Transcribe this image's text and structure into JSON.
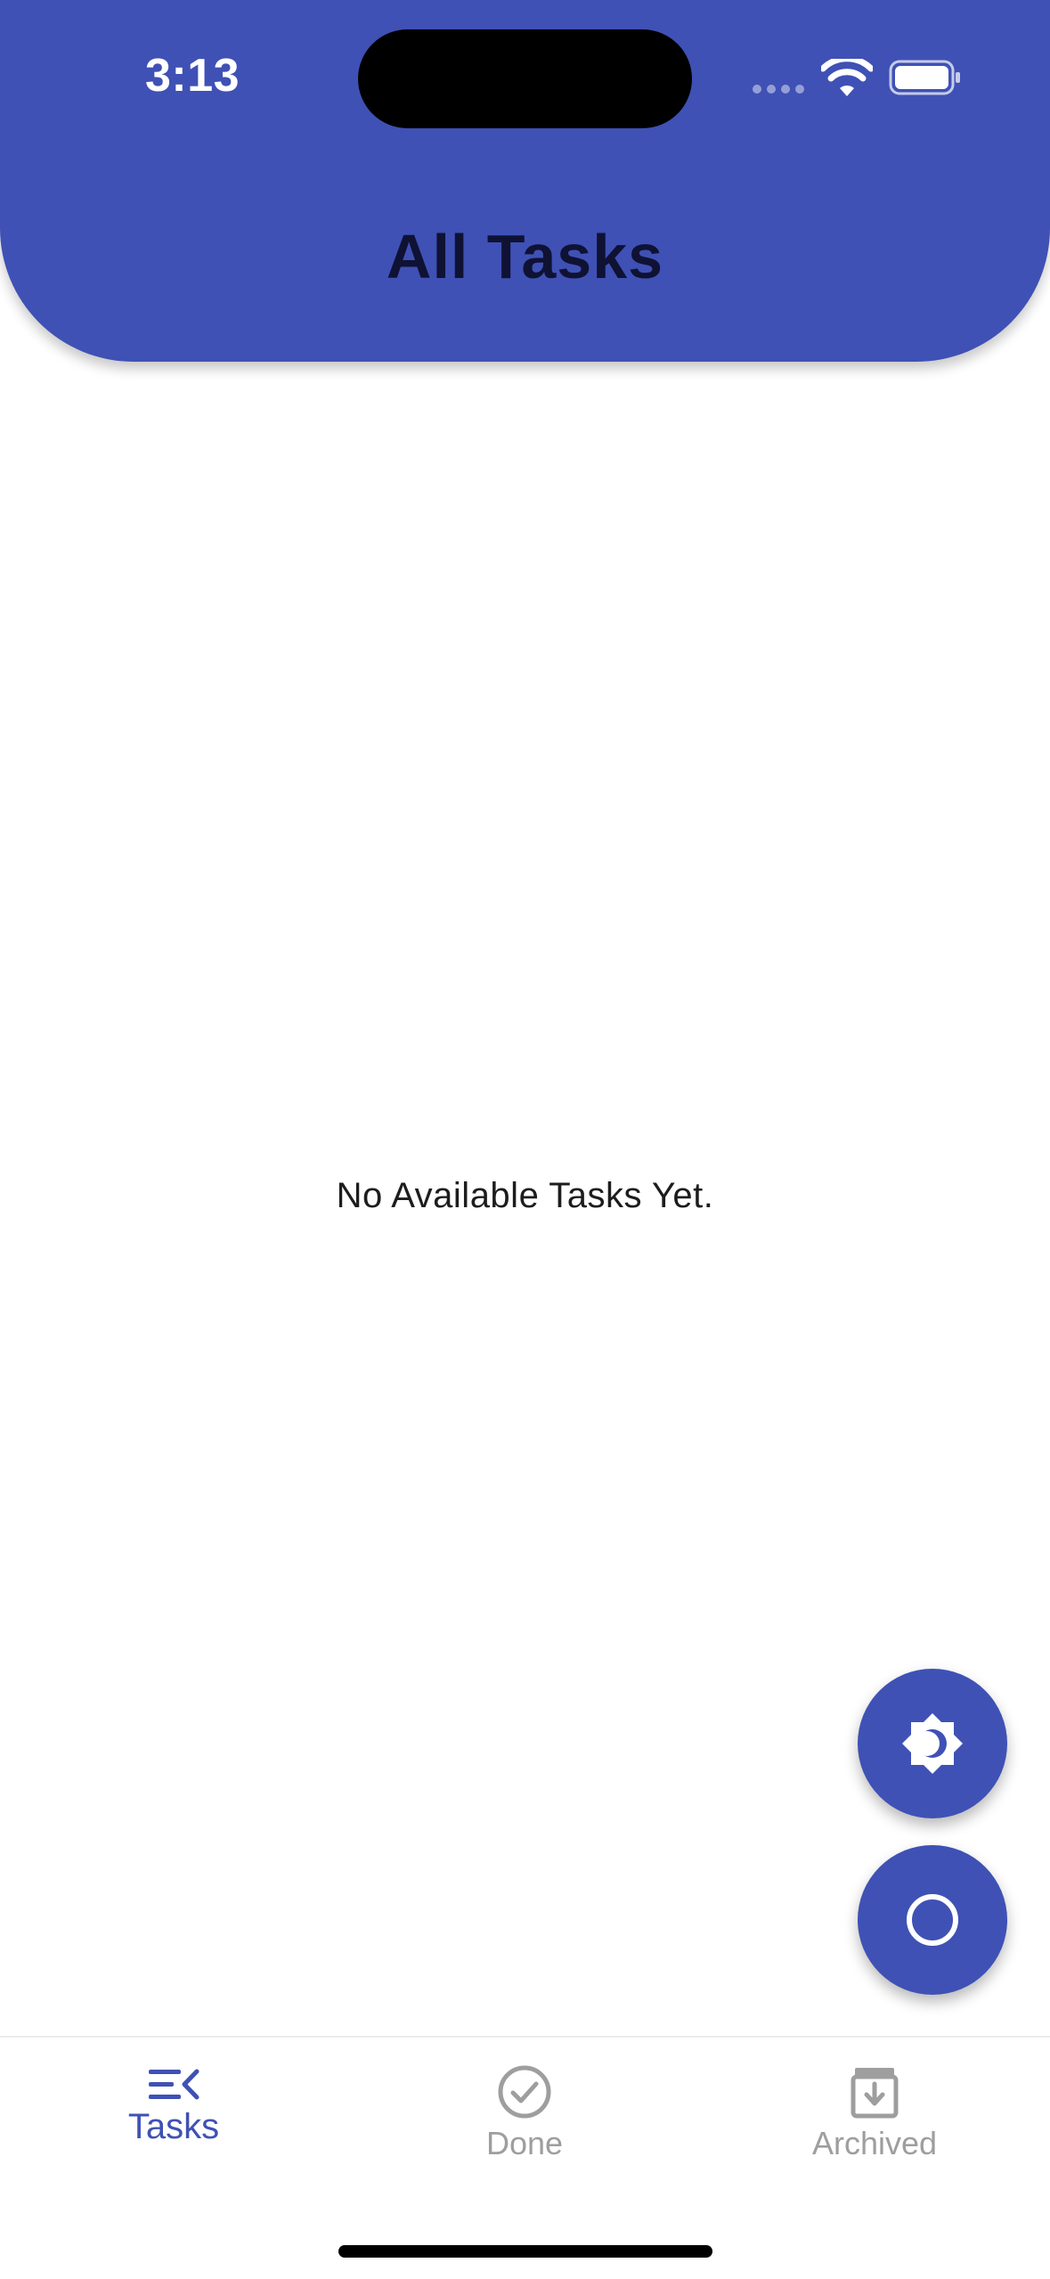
{
  "status_bar": {
    "time": "3:13",
    "icons": [
      "signal-icon",
      "wifi-icon",
      "battery-icon"
    ]
  },
  "header": {
    "title": "All Tasks"
  },
  "main": {
    "empty_message": "No Available Tasks Yet."
  },
  "fabs": {
    "theme_icon": "brightness-icon",
    "add_icon": "circle-icon"
  },
  "bottom_nav": {
    "items": [
      {
        "label": "Tasks",
        "icon": "menu-open-icon",
        "active": true
      },
      {
        "label": "Done",
        "icon": "check-circle-icon",
        "active": false
      },
      {
        "label": "Archived",
        "icon": "archive-icon",
        "active": false
      }
    ]
  },
  "colors": {
    "primary": "#3f51b5",
    "title_text": "#0f1233",
    "inactive": "#9e9e9e",
    "background": "#ffffff"
  }
}
